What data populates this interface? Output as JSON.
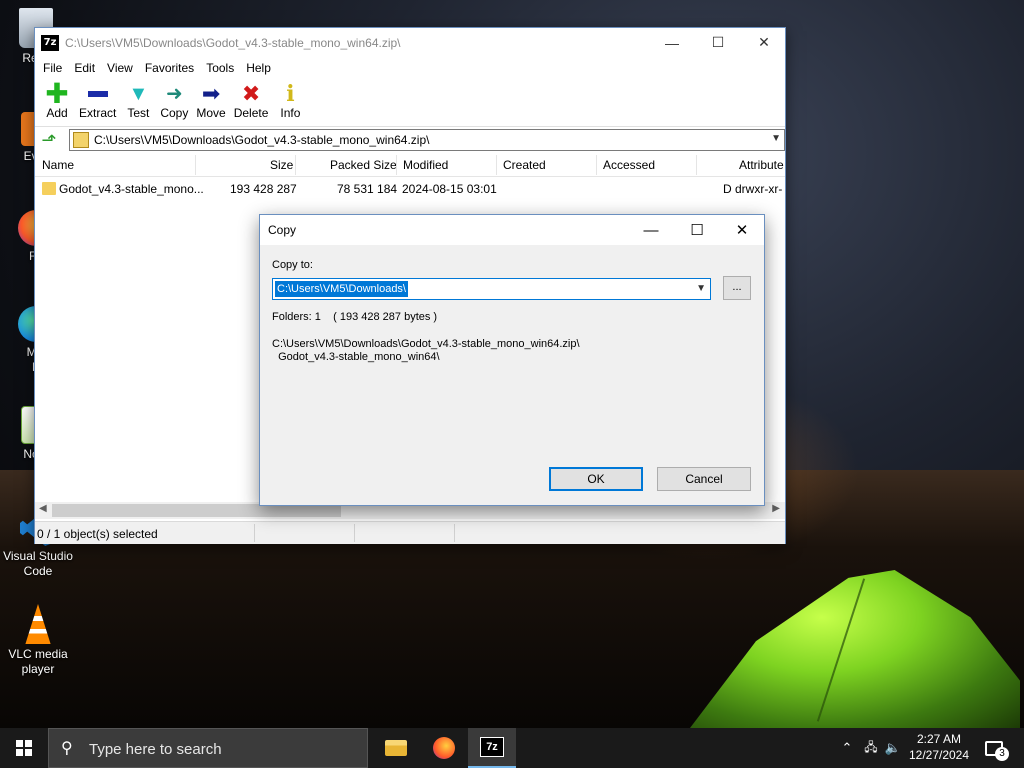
{
  "desktop": {
    "icons": [
      {
        "label": "Recy",
        "icon": "recycle-bin-icon"
      },
      {
        "label": "Ever",
        "icon": "everything-icon"
      },
      {
        "label": "Fir",
        "icon": "firefox-icon"
      },
      {
        "label": "Mic",
        "label2": "E",
        "icon": "edge-icon"
      },
      {
        "label": "Note",
        "icon": "notepad-plus-icon"
      },
      {
        "label": "Visual Studio",
        "label2": "Code",
        "icon": "vscode-icon"
      },
      {
        "label": "VLC media",
        "label2": "player",
        "icon": "vlc-icon"
      }
    ]
  },
  "window": {
    "app_icon": "7z",
    "title": "C:\\Users\\VM5\\Downloads\\Godot_v4.3-stable_mono_win64.zip\\",
    "minimize": "—",
    "maximize": "☐",
    "close": "✕",
    "menu": [
      "File",
      "Edit",
      "View",
      "Favorites",
      "Tools",
      "Help"
    ],
    "toolbar": [
      {
        "label": "Add",
        "icon": "add-icon",
        "color": "#1fb51f"
      },
      {
        "label": "Extract",
        "icon": "extract-icon",
        "color": "#1b2ca8"
      },
      {
        "label": "Test",
        "icon": "test-icon",
        "color": "#1fb9b9"
      },
      {
        "label": "Copy",
        "icon": "copy-icon",
        "color": "#1f8a7a"
      },
      {
        "label": "Move",
        "icon": "move-icon",
        "color": "#12208a"
      },
      {
        "label": "Delete",
        "icon": "delete-icon",
        "color": "#d11a1a"
      },
      {
        "label": "Info",
        "icon": "info-icon",
        "color": "#d1b81a"
      }
    ],
    "address": "C:\\Users\\VM5\\Downloads\\Godot_v4.3-stable_mono_win64.zip\\",
    "columns": [
      "Name",
      "Size",
      "Packed Size",
      "Modified",
      "Created",
      "Accessed",
      "Attribute"
    ],
    "rows": [
      {
        "name": "Godot_v4.3-stable_mono...",
        "size": "193 428 287",
        "packed": "78 531 184",
        "modified": "2024-08-15 03:01",
        "created": "",
        "accessed": "",
        "attr": "D drwxr-xr-"
      }
    ],
    "status": "0 / 1 object(s) selected"
  },
  "dialog": {
    "title": "Copy",
    "minimize": "—",
    "maximize": "☐",
    "close": "✕",
    "copy_to_label": "Copy to:",
    "copy_to_value": "C:\\Users\\VM5\\Downloads\\",
    "browse_label": "...",
    "folders_info": "Folders: 1    ( 193 428 287 bytes )",
    "path_line1": "C:\\Users\\VM5\\Downloads\\Godot_v4.3-stable_mono_win64.zip\\",
    "path_line2": "  Godot_v4.3-stable_mono_win64\\",
    "ok_label": "OK",
    "cancel_label": "Cancel"
  },
  "taskbar": {
    "search_placeholder": "Type here to search",
    "apps": [
      "file-explorer-icon",
      "firefox-icon",
      "7zip-icon"
    ],
    "seven_zip_label": "7z",
    "time": "2:27 AM",
    "date": "12/27/2024",
    "notification_count": "3"
  }
}
